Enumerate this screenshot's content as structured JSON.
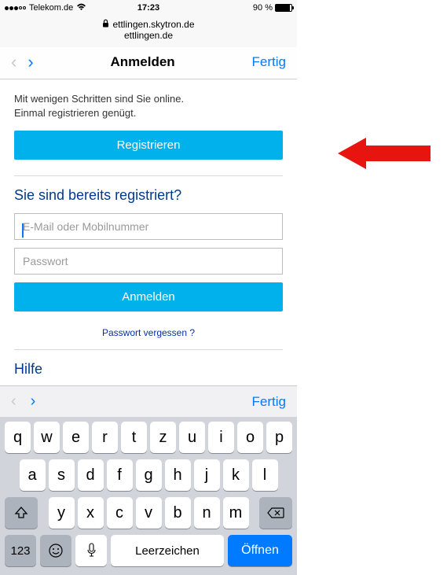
{
  "status_bar": {
    "carrier": "Telekom.de",
    "wifi": true,
    "time": "17:23",
    "battery_pct": "90 %"
  },
  "url": {
    "line1": "ettlingen.skytron.de",
    "line2": "ettlingen.de"
  },
  "nav": {
    "title": "Anmelden",
    "done": "Fertig"
  },
  "page": {
    "intro1": "Mit wenigen Schritten sind Sie online.",
    "intro2": "Einmal registrieren genügt.",
    "register_btn": "Registrieren",
    "already_title": "Sie sind bereits registriert?",
    "email_placeholder": "E-Mail oder Mobilnummer",
    "password_placeholder": "Passwort",
    "login_btn": "Anmelden",
    "forgot": "Passwort vergessen ?",
    "help": "Hilfe"
  },
  "kb_toolbar": {
    "done": "Fertig"
  },
  "keyboard": {
    "row1": [
      "q",
      "w",
      "e",
      "r",
      "t",
      "z",
      "u",
      "i",
      "o",
      "p"
    ],
    "row2": [
      "a",
      "s",
      "d",
      "f",
      "g",
      "h",
      "j",
      "k",
      "l"
    ],
    "row3": [
      "y",
      "x",
      "c",
      "v",
      "b",
      "n",
      "m"
    ],
    "numkey": "123",
    "space": "Leerzeichen",
    "open": "Öffnen"
  }
}
